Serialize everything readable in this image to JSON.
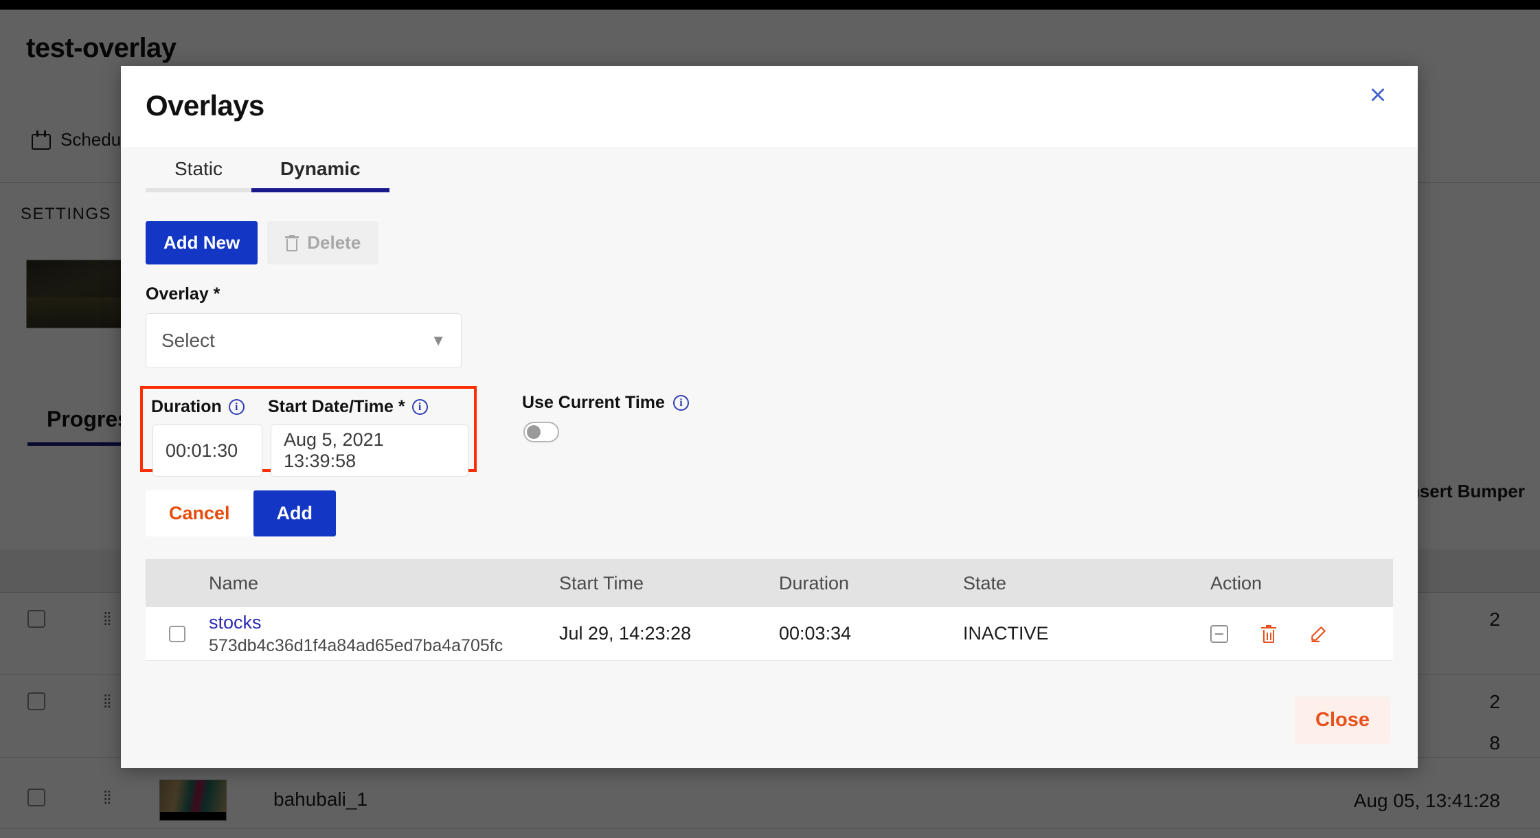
{
  "background": {
    "page_title": "test-overlay",
    "schedule_label": "Schedule",
    "settings_label": "SETTINGS",
    "progress_tab_label": "Progress",
    "insert_bumper_label": "Insert Bumper",
    "rows": [
      {
        "count": "2"
      },
      {
        "count": "2"
      },
      {
        "count": "8"
      }
    ],
    "last_item_name": "bahubali_1",
    "last_item_time": "Aug 05, 13:41:28"
  },
  "modal": {
    "title": "Overlays",
    "close_icon": "close-x-icon",
    "tabs": [
      {
        "label": "Static",
        "active": false
      },
      {
        "label": "Dynamic",
        "active": true
      }
    ],
    "toolbar": {
      "add_new_label": "Add New",
      "delete_label": "Delete",
      "delete_icon": "trash-icon"
    },
    "form": {
      "overlay_label": "Overlay *",
      "overlay_value": "Select",
      "overlay_caret": "chevron-down-icon",
      "duration_label": "Duration",
      "duration_info_icon": "info-icon",
      "duration_value": "00:01:30",
      "start_datetime_label": "Start Date/Time *",
      "start_datetime_info_icon": "info-icon",
      "start_datetime_value": "Aug 5, 2021 13:39:58",
      "use_current_time_label": "Use Current Time",
      "use_current_time_info_icon": "info-icon",
      "use_current_time_on": false,
      "cancel_label": "Cancel",
      "add_label": "Add",
      "highlight_color": "#fb2e04"
    },
    "table": {
      "columns": [
        "Name",
        "Start Time",
        "Duration",
        "State",
        "Action"
      ],
      "rows": [
        {
          "checked": false,
          "name": "stocks",
          "id": "573db4c36d1f4a84ad65ed7ba4a705fc",
          "start_time": "Jul 29, 14:23:28",
          "duration": "00:03:34",
          "state": "INACTIVE",
          "actions": [
            "minus-box-icon",
            "trash-icon",
            "pencil-edit-icon"
          ]
        }
      ]
    },
    "footer": {
      "close_label": "Close"
    }
  },
  "colors": {
    "primary_blue": "#1336c4",
    "tab_active": "#1a1a8c",
    "accent_orange": "#e8501c",
    "highlight_red": "#fb2e04",
    "link_blue": "#2a2ab5"
  }
}
